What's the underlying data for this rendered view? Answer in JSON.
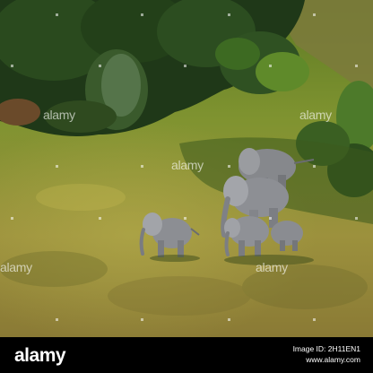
{
  "photo": {
    "watermark_text": "alamy",
    "subject": "elephant herd with calves walking through golden savanna grass, seen from above"
  },
  "footer": {
    "brand": "alamy",
    "image_id": "Image ID: 2H11EN1",
    "url": "www.alamy.com"
  },
  "colors": {
    "footer_background": "#000000",
    "grass_gold": "#a99a3f",
    "grass_green": "#6e8a2c",
    "bush_dark": "#1f3818",
    "elephant_grey": "#8a8c91"
  }
}
